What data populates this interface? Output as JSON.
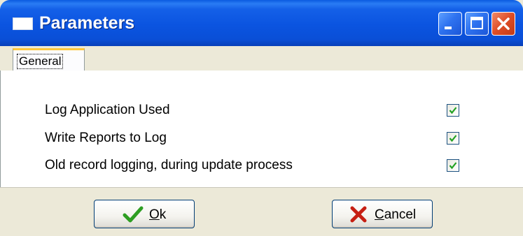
{
  "window": {
    "title": "Parameters",
    "icon": "window-icon",
    "controls": [
      "minimize-icon",
      "maximize-icon",
      "close-icon"
    ],
    "title_color": "#0a54e0"
  },
  "tabs": [
    {
      "label": "General",
      "selected": true
    }
  ],
  "options": [
    {
      "label": "Log Application Used",
      "checked": true
    },
    {
      "label": "Write Reports to Log",
      "checked": true
    },
    {
      "label": "Old record logging, during update process",
      "checked": true
    }
  ],
  "buttons": {
    "ok": {
      "mnemonic": "O",
      "rest": "k",
      "icon": "checkmark-icon",
      "icon_color": "#2e9e22"
    },
    "cancel": {
      "mnemonic": "C",
      "rest": "ancel",
      "icon": "x-icon",
      "icon_color": "#c61f12"
    }
  }
}
